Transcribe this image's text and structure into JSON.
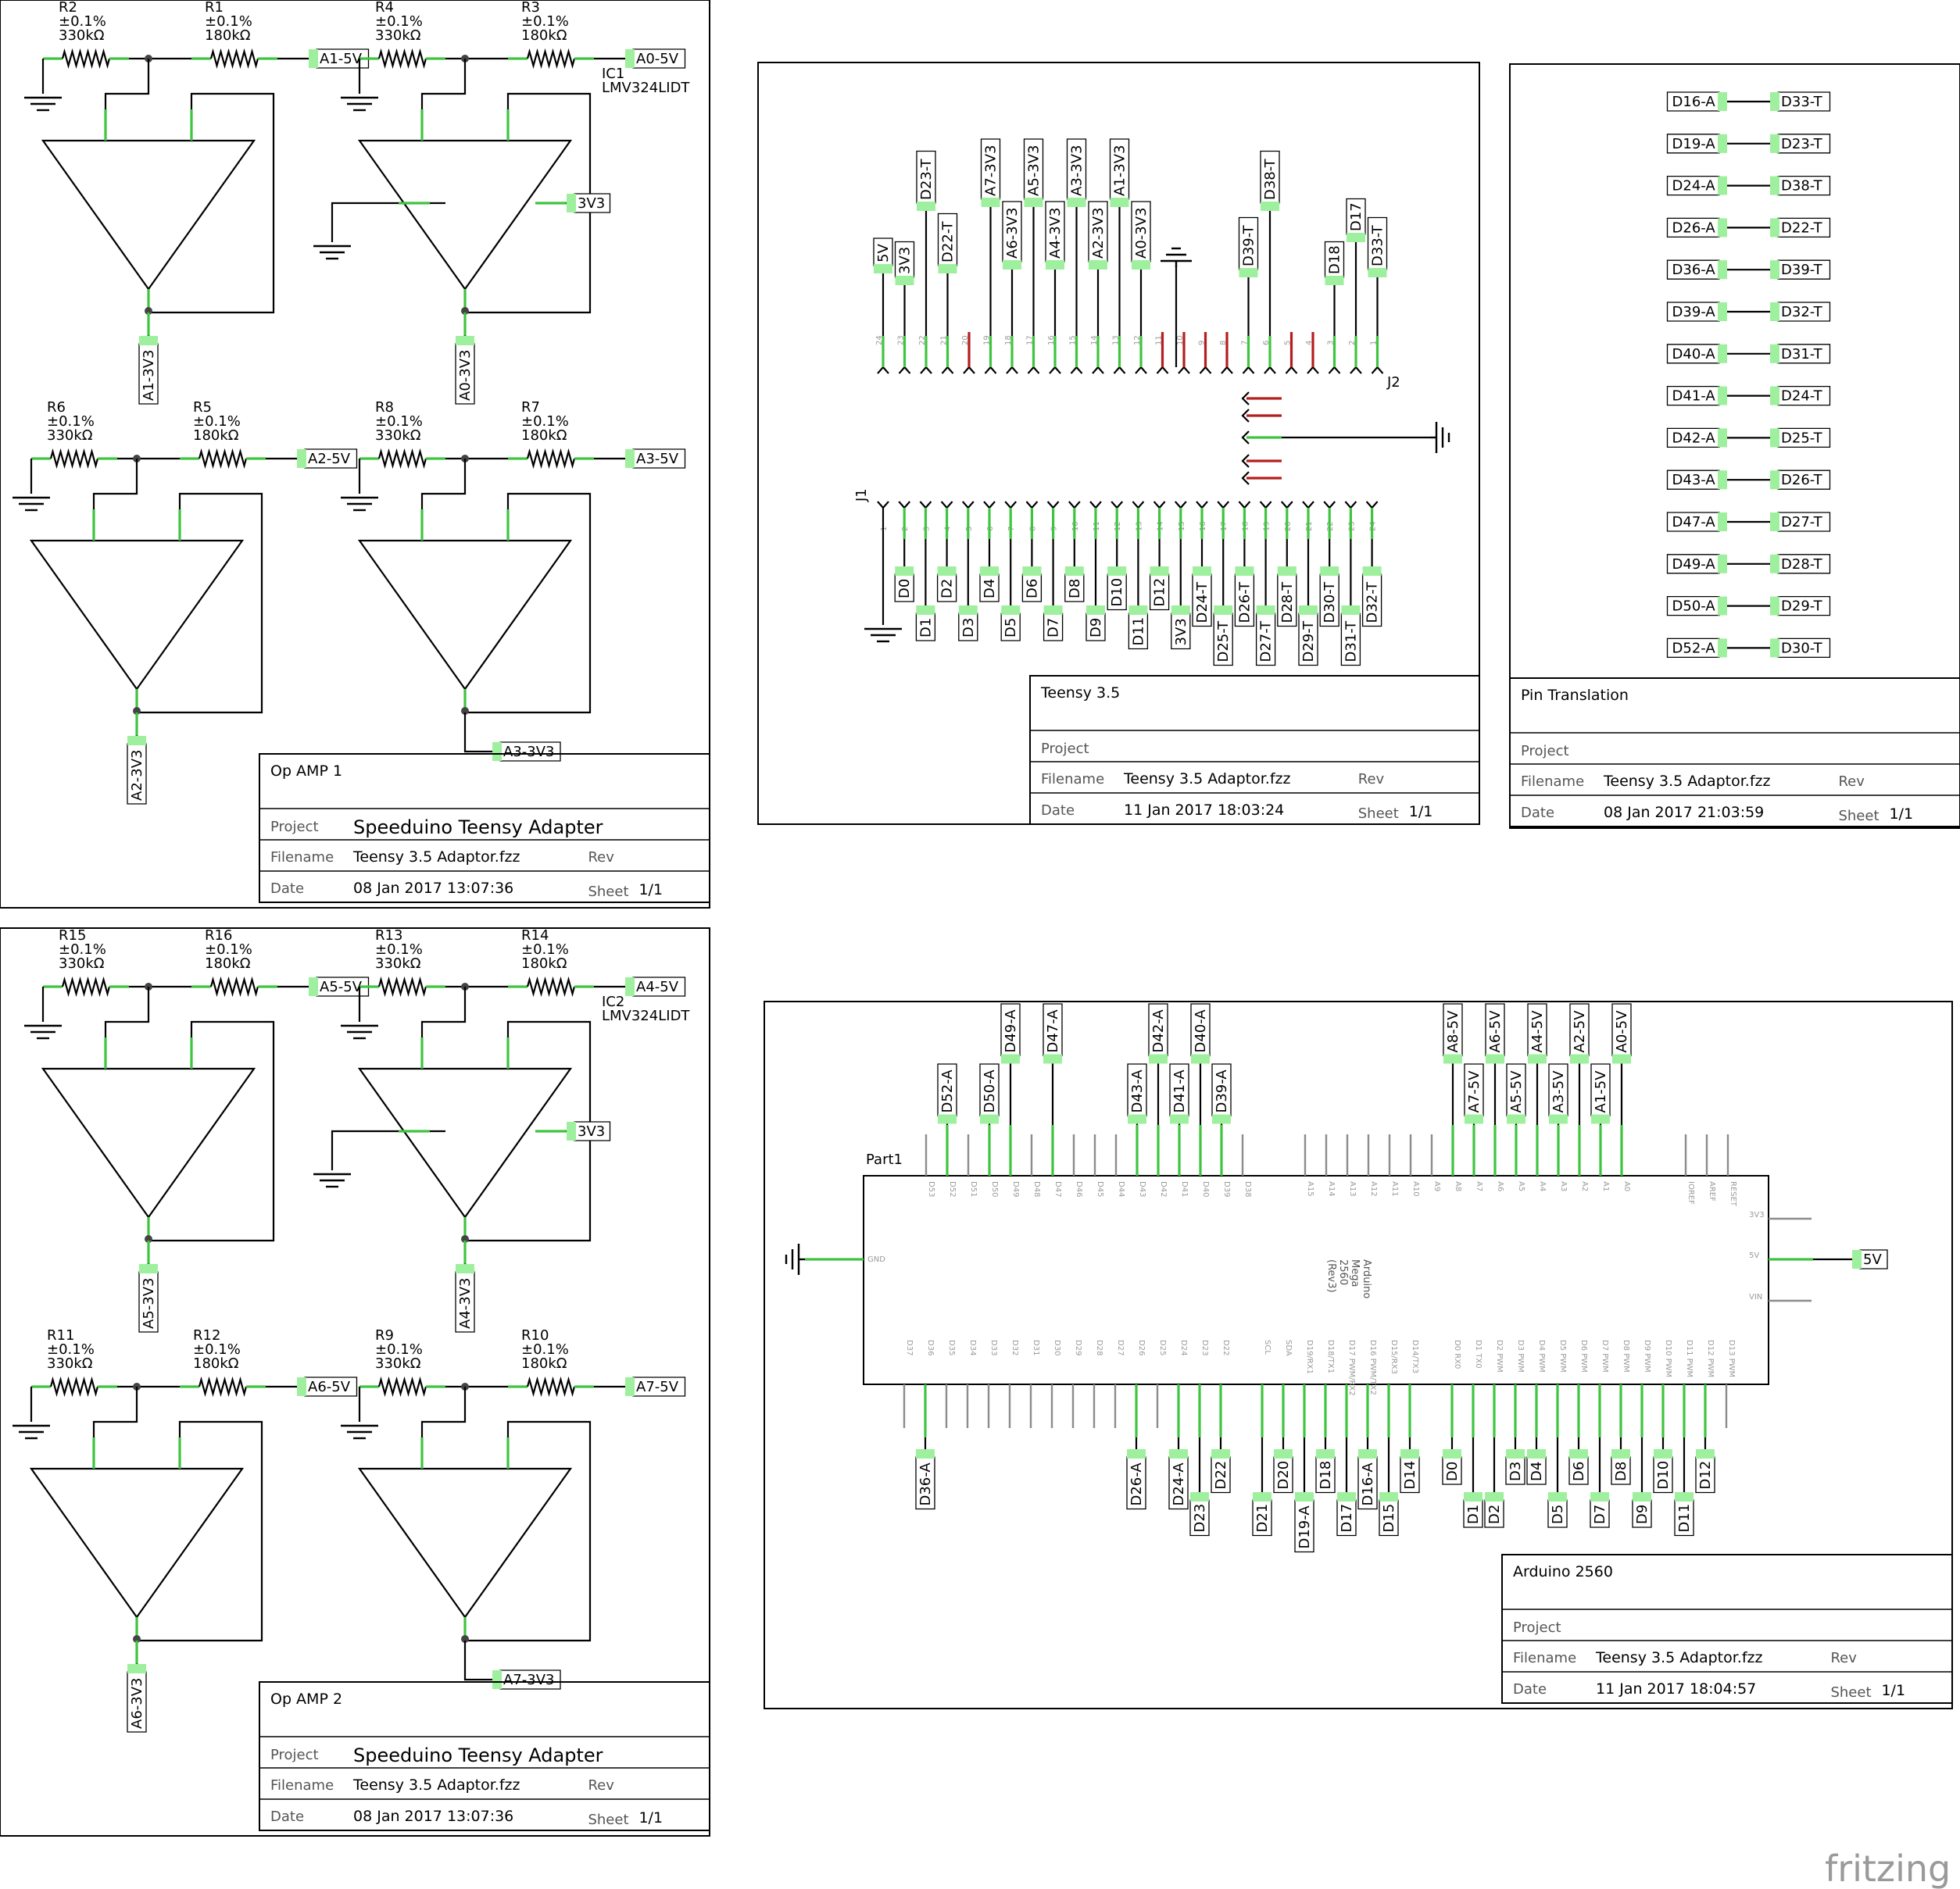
{
  "opamp1": {
    "resistors": [
      {
        "ref": "R2",
        "tol": "±0.1%",
        "val": "330kΩ"
      },
      {
        "ref": "R1",
        "tol": "±0.1%",
        "val": "180kΩ"
      },
      {
        "ref": "R4",
        "tol": "±0.1%",
        "val": "330kΩ"
      },
      {
        "ref": "R3",
        "tol": "±0.1%",
        "val": "180kΩ"
      },
      {
        "ref": "R6",
        "tol": "±0.1%",
        "val": "330kΩ"
      },
      {
        "ref": "R5",
        "tol": "±0.1%",
        "val": "180kΩ"
      },
      {
        "ref": "R8",
        "tol": "±0.1%",
        "val": "330kΩ"
      },
      {
        "ref": "R7",
        "tol": "±0.1%",
        "val": "180kΩ"
      }
    ],
    "ic": {
      "ref": "IC1",
      "part": "LMV324LIDT"
    },
    "inputs": [
      "A1-5V",
      "A0-5V",
      "A2-5V",
      "A3-5V"
    ],
    "outputs": [
      "A1-3V3",
      "A0-3V3",
      "A2-3V3",
      "A3-3V3"
    ],
    "supply": "3V3",
    "title_block": {
      "title": "Op AMP 1",
      "project_label": "Project",
      "project": "Speeduino Teensy Adapter",
      "filename_label": "Filename",
      "filename": "Teensy 3.5 Adaptor.fzz",
      "rev_label": "Rev",
      "date_label": "Date",
      "date": "08 Jan 2017 13:07:36",
      "sheet_label": "Sheet",
      "sheet": "1/1"
    }
  },
  "opamp2": {
    "resistors": [
      {
        "ref": "R15",
        "tol": "±0.1%",
        "val": "330kΩ"
      },
      {
        "ref": "R16",
        "tol": "±0.1%",
        "val": "180kΩ"
      },
      {
        "ref": "R13",
        "tol": "±0.1%",
        "val": "330kΩ"
      },
      {
        "ref": "R14",
        "tol": "±0.1%",
        "val": "180kΩ"
      },
      {
        "ref": "R11",
        "tol": "±0.1%",
        "val": "330kΩ"
      },
      {
        "ref": "R12",
        "tol": "±0.1%",
        "val": "180kΩ"
      },
      {
        "ref": "R9",
        "tol": "±0.1%",
        "val": "330kΩ"
      },
      {
        "ref": "R10",
        "tol": "±0.1%",
        "val": "180kΩ"
      }
    ],
    "ic": {
      "ref": "IC2",
      "part": "LMV324LIDT"
    },
    "inputs": [
      "A5-5V",
      "A4-5V",
      "A6-5V",
      "A7-5V"
    ],
    "outputs": [
      "A5-3V3",
      "A4-3V3",
      "A6-3V3",
      "A7-3V3"
    ],
    "supply": "3V3",
    "title_block": {
      "title": "Op AMP 2",
      "project_label": "Project",
      "project": "Speeduino Teensy Adapter",
      "filename_label": "Filename",
      "filename": "Teensy 3.5 Adaptor.fzz",
      "rev_label": "Rev",
      "date_label": "Date",
      "date": "08 Jan 2017 13:07:36",
      "sheet_label": "Sheet",
      "sheet": "1/1"
    }
  },
  "teensy": {
    "j2_label": "J2",
    "j1_label": "J1",
    "j2_top_labels": [
      "5V",
      "3V3",
      "D23-T",
      "D22-T",
      "A7-3V3",
      "A6-3V3",
      "A5-3V3",
      "A4-3V3",
      "A3-3V3",
      "A2-3V3",
      "A1-3V3",
      "A0-3V3",
      "D39-T",
      "D38-T",
      "D18",
      "D17",
      "D33-T"
    ],
    "j1_bottom_labels": [
      "D0",
      "D1",
      "D2",
      "D3",
      "D4",
      "D5",
      "D6",
      "D7",
      "D8",
      "D9",
      "D10",
      "D11",
      "D12",
      "3V3",
      "D24-T",
      "D25-T",
      "D26-T",
      "D27-T",
      "D28-T",
      "D29-T",
      "D30-T",
      "D31-T",
      "D32-T"
    ],
    "title_block": {
      "title": "Teensy 3.5",
      "project_label": "Project",
      "project": "",
      "filename_label": "Filename",
      "filename": "Teensy 3.5 Adaptor.fzz",
      "rev_label": "Rev",
      "date_label": "Date",
      "date": "11 Jan 2017 18:03:24",
      "sheet_label": "Sheet",
      "sheet": "1/1"
    }
  },
  "translation": {
    "pairs": [
      [
        "D16-A",
        "D33-T"
      ],
      [
        "D19-A",
        "D23-T"
      ],
      [
        "D24-A",
        "D38-T"
      ],
      [
        "D26-A",
        "D22-T"
      ],
      [
        "D36-A",
        "D39-T"
      ],
      [
        "D39-A",
        "D32-T"
      ],
      [
        "D40-A",
        "D31-T"
      ],
      [
        "D41-A",
        "D24-T"
      ],
      [
        "D42-A",
        "D25-T"
      ],
      [
        "D43-A",
        "D26-T"
      ],
      [
        "D47-A",
        "D27-T"
      ],
      [
        "D49-A",
        "D28-T"
      ],
      [
        "D50-A",
        "D29-T"
      ],
      [
        "D52-A",
        "D30-T"
      ]
    ],
    "title_block": {
      "title": "Pin Translation",
      "project_label": "Project",
      "project": "",
      "filename_label": "Filename",
      "filename": "Teensy 3.5 Adaptor.fzz",
      "rev_label": "Rev",
      "date_label": "Date",
      "date": "08 Jan 2017 21:03:59",
      "sheet_label": "Sheet",
      "sheet": "1/1"
    }
  },
  "arduino": {
    "part_label": "Part1",
    "name_lines": [
      "Arduino",
      "Mega",
      "2560",
      "(Rev3)"
    ],
    "top_pins": [
      "D53",
      "D52",
      "D51",
      "D50",
      "D49",
      "D48",
      "D47",
      "D46",
      "D45",
      "D44",
      "D43",
      "D42",
      "D41",
      "D40",
      "D39",
      "D38",
      "A15",
      "A14",
      "A13",
      "A12",
      "A11",
      "A10",
      "A9",
      "A8",
      "A7",
      "A6",
      "A5",
      "A4",
      "A3",
      "A2",
      "A1",
      "A0",
      "IOREF",
      "AREF",
      "RESET"
    ],
    "bottom_pins": [
      "D37",
      "D36",
      "D35",
      "D34",
      "D33",
      "D32",
      "D31",
      "D30",
      "D29",
      "D28",
      "D27",
      "D26",
      "D25",
      "D24",
      "D23",
      "D22",
      "SCL",
      "SDA",
      "D19/RX1",
      "D18/TX1",
      "D17 PWM/RX2",
      "D16 PWM/TX2",
      "D15/RX3",
      "D14/TX3",
      "D0 RX0",
      "D1 TX0",
      "D2 PWM",
      "D3 PWM",
      "D4 PWM",
      "D5 PWM",
      "D6 PWM",
      "D7 PWM",
      "D8 PWM",
      "D9 PWM",
      "D10 PWM",
      "D11 PWM",
      "D12 PWM",
      "D13 PWM"
    ],
    "left_pin": "GND",
    "right_pins": [
      "3V3",
      "5V",
      "VIN"
    ],
    "right_flag": "5V",
    "top_flags": [
      "D52-A",
      "D50-A",
      "D49-A",
      "D47-A",
      "D43-A",
      "D42-A",
      "D41-A",
      "D40-A",
      "D39-A",
      "A8-5V",
      "A7-5V",
      "A6-5V",
      "A5-5V",
      "A4-5V",
      "A3-5V",
      "A2-5V",
      "A1-5V",
      "A0-5V"
    ],
    "bottom_flags": [
      "D36-A",
      "D26-A",
      "D24-A",
      "D23",
      "D22",
      "D21",
      "D20",
      "D19-A",
      "D18",
      "D17",
      "D16-A",
      "D15",
      "D14",
      "D0",
      "D1",
      "D2",
      "D3",
      "D4",
      "D5",
      "D6",
      "D7",
      "D8",
      "D9",
      "D10",
      "D11",
      "D12"
    ],
    "title_block": {
      "title": "Arduino 2560",
      "project_label": "Project",
      "project": "",
      "filename_label": "Filename",
      "filename": "Teensy 3.5 Adaptor.fzz",
      "rev_label": "Rev",
      "date_label": "Date",
      "date": "11 Jan 2017 18:04:57",
      "sheet_label": "Sheet",
      "sheet": "1/1"
    }
  },
  "brand": "fritzing"
}
